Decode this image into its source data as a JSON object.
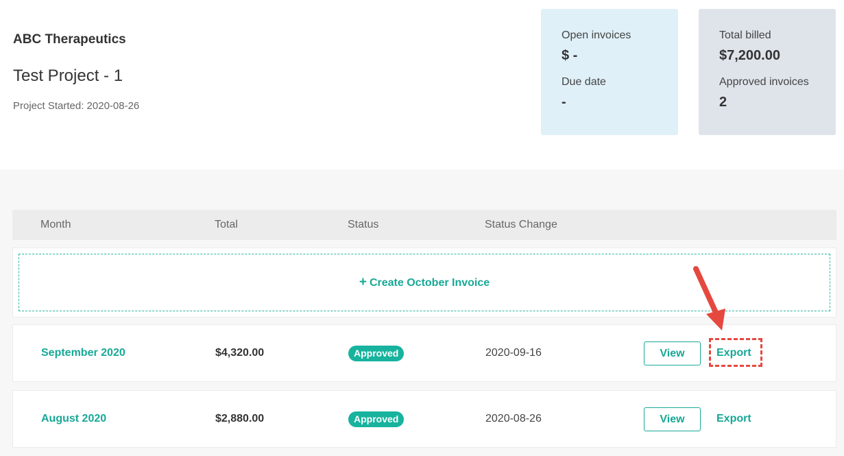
{
  "header": {
    "company": "ABC Therapeutics",
    "project": "Test Project - 1",
    "started": "Project Started: 2020-08-26"
  },
  "summary": {
    "open_invoices_label": "Open invoices",
    "open_invoices_value": "$ -",
    "due_date_label": "Due date",
    "due_date_value": "-",
    "total_billed_label": "Total billed",
    "total_billed_value": "$7,200.00",
    "approved_label": "Approved invoices",
    "approved_value": "2"
  },
  "table": {
    "columns": [
      "Month",
      "Total",
      "Status",
      "Status Change"
    ],
    "create_label": "Create October Invoice",
    "rows": [
      {
        "month": "September 2020",
        "total": "$4,320.00",
        "status": "Approved",
        "status_change": "2020-09-16",
        "view": "View",
        "export": "Export"
      },
      {
        "month": "August 2020",
        "total": "$2,880.00",
        "status": "Approved",
        "status_change": "2020-08-26",
        "view": "View",
        "export": "Export"
      }
    ]
  },
  "colors": {
    "accent": "#17a896",
    "open_card": "#dff0f8",
    "total_card": "#dfe4eb",
    "annotation": "#e5483f"
  },
  "icons": [
    "plus-icon",
    "annotation-arrow-icon"
  ]
}
